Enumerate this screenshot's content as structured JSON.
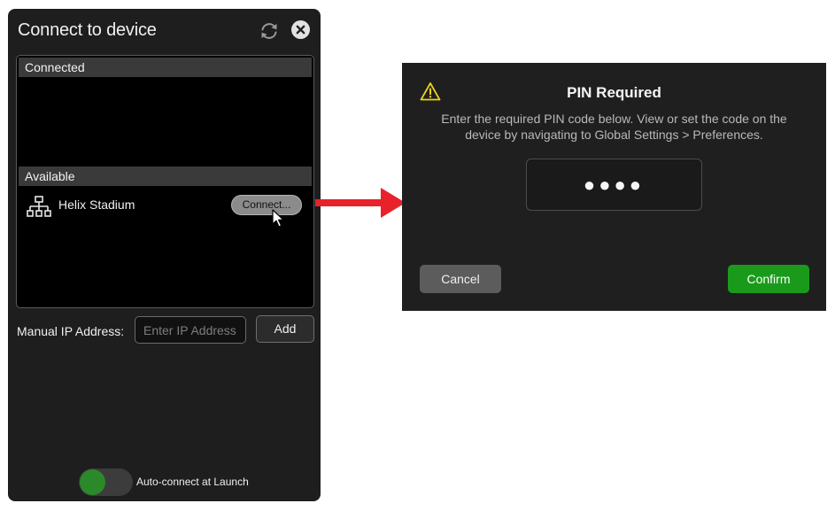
{
  "connect_panel": {
    "title": "Connect to device",
    "sections": {
      "connected_label": "Connected",
      "available_label": "Available"
    },
    "devices": [
      {
        "name": "Helix Stadium",
        "connect_label": "Connect..."
      }
    ],
    "manual_ip": {
      "label": "Manual IP Address:",
      "placeholder": "Enter IP Address",
      "value": "",
      "add_label": "Add"
    },
    "auto_connect": {
      "label": "Auto-connect at Launch",
      "enabled": true
    },
    "icons": {
      "refresh": "refresh-icon",
      "close": "close-icon",
      "device": "network-icon",
      "cursor": "cursor-icon"
    }
  },
  "pin_dialog": {
    "title": "PIN Required",
    "message": "Enter the required PIN code below. View or set the code on the device by navigating to Global Settings > Preferences.",
    "pin_masked": "●●●●",
    "cancel_label": "Cancel",
    "confirm_label": "Confirm",
    "icons": {
      "warning": "warning-icon"
    }
  },
  "colors": {
    "panel_bg": "#1e1e1e",
    "dialog_bg": "#1f1f1f",
    "confirm_green": "#1a9a1a",
    "toggle_green": "#2a8a2a",
    "arrow_red": "#e8222a",
    "warning_yellow": "#e8d21e"
  }
}
